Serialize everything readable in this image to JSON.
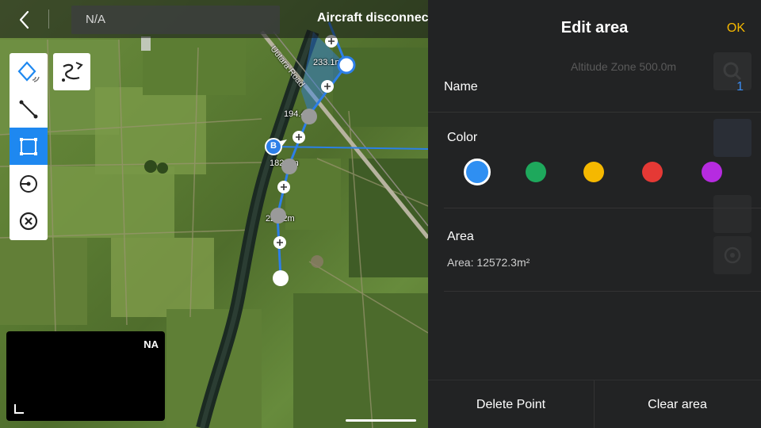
{
  "topbar": {
    "back_icon": "chevron-left-icon",
    "status_text": "N/A",
    "connection_text": "Aircraft disconnected"
  },
  "tools": [
    {
      "name": "waypoint-mode-icon",
      "active": false
    },
    {
      "name": "line-tool-icon",
      "active": false
    },
    {
      "name": "area-tool-icon",
      "active": true
    },
    {
      "name": "orbit-tool-icon",
      "active": false
    },
    {
      "name": "clear-tool-icon",
      "active": false
    }
  ],
  "route_tool_icon": "route-curve-icon",
  "map": {
    "distance_labels": [
      "233.1m",
      "194.4m",
      "182.1m",
      "226.2m"
    ],
    "road_label": "Uutara Road",
    "marker_label": "B"
  },
  "mini_view": {
    "label": "NA"
  },
  "panel": {
    "title": "Edit area",
    "ok_label": "OK",
    "name_label": "Name",
    "name_value": "1",
    "color_label": "Color",
    "colors": [
      "#2f8ff2",
      "#1ea85c",
      "#f5b800",
      "#e53935",
      "#b62be0"
    ],
    "selected_color_index": 0,
    "area_label": "Area",
    "area_value": "Area: 12572.3m²",
    "delete_point_label": "Delete Point",
    "clear_area_label": "Clear area",
    "ghost_altitude": "Altitude Zone 500.0m"
  }
}
